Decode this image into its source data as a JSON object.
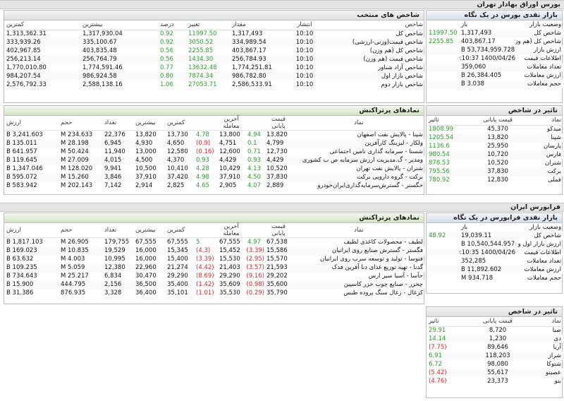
{
  "page": {
    "tse_title": "بورس اوراق بهادار تهران",
    "ifb_title": "فرابورس ایران"
  },
  "tse_indices": {
    "title": "شاخص های منتخب",
    "headers": [
      "شاخص",
      "انتشار",
      "مقدار",
      "تغییر",
      "درصد",
      "بیشترین",
      "کمترین"
    ],
    "rows": [
      {
        "name": "شاخص کل",
        "time": "10:10",
        "value": "1,317,493",
        "change": "11997.50",
        "pct": "0.92",
        "high": "1,317,930.04",
        "low": "1,313,362.31",
        "dir": "pos"
      },
      {
        "name": "شاخص قیمت(وزنی-ارزشی)",
        "time": "10:10",
        "value": "334,989.54",
        "change": "3050.52",
        "pct": "0.92",
        "high": "335,100.67",
        "low": "333,939.26",
        "dir": "pos"
      },
      {
        "name": "شاخص کل (هم وزن)",
        "time": "10:10",
        "value": "403,867.17",
        "change": "2255.85",
        "pct": "0.56",
        "high": "403,835.48",
        "low": "402,967.85",
        "dir": "pos"
      },
      {
        "name": "شاخص قیمت (هم وزن)",
        "time": "10:10",
        "value": "256,784.93",
        "change": "1434.30",
        "pct": "0.56",
        "high": "256,764.79",
        "low": "256,213.14",
        "dir": "pos"
      },
      {
        "name": "شاخص آزاد شناور",
        "time": "10:10",
        "value": "1,774,251.81",
        "change": "13632.48",
        "pct": "0.77",
        "high": "1,774,591.46",
        "low": "1,770,010.80",
        "dir": "pos"
      },
      {
        "name": "شاخص بازار اول",
        "time": "10:10",
        "value": "986,782.80",
        "change": "7874.34",
        "pct": "0.80",
        "high": "986,924.58",
        "low": "984,207.54",
        "dir": "pos"
      },
      {
        "name": "شاخص بازار دوم",
        "time": "10:10",
        "value": "2,586,533.91",
        "change": "27053.71",
        "pct": "1.06",
        "high": "2,588,138.16",
        "low": "2,576,792.33",
        "dir": "pos"
      }
    ]
  },
  "tse_overview": {
    "title": "بازار نقدی بورس در یک نگاه",
    "rows": [
      {
        "label": "وضعیت بازار",
        "value": "باز",
        "extra": ""
      },
      {
        "label": "شاخص کل",
        "value": "1,317,493",
        "extra": "11997.50"
      },
      {
        "label": "شاخص کل (هم وزن)",
        "value": "403,867.17",
        "extra": "2255.85"
      },
      {
        "label": "ارزش بازار",
        "value": "53,734,959.728 B",
        "extra": ""
      },
      {
        "label": "اطلاعات قیمت",
        "value": "1400/04/26 10:10:37",
        "extra": ""
      },
      {
        "label": "تعداد معاملات",
        "value": "359,060",
        "extra": ""
      },
      {
        "label": "ارزش معاملات",
        "value": "26,384.405 B",
        "extra": ""
      },
      {
        "label": "حجم معاملات",
        "value": "3.038 B",
        "extra": ""
      }
    ]
  },
  "tse_top": {
    "title": "نمادهای پرتراکنش",
    "headers": [
      "نماد",
      "قیمت پایانی",
      "",
      "آخرین معامله",
      "",
      "کمترین",
      "بیشترین",
      "تعداد",
      "حجم",
      "ارزش"
    ],
    "rows": [
      {
        "name": "شپنا - پالایش نفت اصفهان",
        "close": "13,820",
        "close_pct": "4.94",
        "last": "13,800",
        "last_pct": "4.78",
        "low": "13,730",
        "high": "13,820",
        "count": "22,376",
        "volume": "234.633 M",
        "value": "3,241.603 B",
        "cdir": "pos",
        "ldir": "pos"
      },
      {
        "name": "ولکار - لیزینگ کارآفرین",
        "close": "4,799",
        "close_pct": "0.1",
        "last": "4,751",
        "last_pct": "(0.9)",
        "low": "4,650",
        "high": "4,930",
        "count": "6,945",
        "volume": "28.198 M",
        "value": "135.011 B",
        "cdir": "pos",
        "ldir": "neg"
      },
      {
        "name": "شستا - سرمایه گذاری تامین اجتماعی",
        "close": "12,730",
        "close_pct": "0.71",
        "last": "12,600",
        "last_pct": "(0.16)",
        "low": "12,580",
        "high": "13,000",
        "count": "11,940",
        "volume": "50.424 M",
        "value": "641.957 B",
        "cdir": "pos",
        "ldir": "neg"
      },
      {
        "name": "ومدیر - گ.مدیریت ارزش سرمایه ص ب کشوری",
        "close": "4,429",
        "close_pct": "0.93",
        "last": "4,429",
        "last_pct": "0.93",
        "low": "4,370",
        "high": "4,500",
        "count": "4,015",
        "volume": "27.009 M",
        "value": "119.645 B",
        "cdir": "pos",
        "ldir": "pos"
      },
      {
        "name": "شتران - پالایش نفت تهران",
        "close": "10,520",
        "close_pct": "4.13",
        "last": "10,429",
        "last_pct": "4.28",
        "low": "10,410",
        "high": "10,500",
        "count": "9,941",
        "volume": "128.020 M",
        "value": "1,347.046 B",
        "cdir": "pos",
        "ldir": "pos"
      },
      {
        "name": "برکت - گروه دارویی برکت",
        "close": "37,830",
        "close_pct": "4.50",
        "last": "37,910",
        "last_pct": "4.98",
        "low": "37,420",
        "high": "37,910",
        "count": "3,846",
        "volume": "15.260 M",
        "value": "595.072 B",
        "cdir": "pos",
        "ldir": "pos"
      },
      {
        "name": "خگستر - گسترش‌سرمایه‌گذاری‌ایران‌خودرو",
        "close": "2,889",
        "close_pct": "4.07",
        "last": "2,905",
        "last_pct": "4.65",
        "low": "2,825",
        "high": "2,914",
        "count": "7,142",
        "volume": "202.143 M",
        "value": "583.942 B",
        "cdir": "pos",
        "ldir": "pos"
      }
    ]
  },
  "tse_impact": {
    "title": "تاثیر در شاخص",
    "headers": [
      "نماد",
      "قیمت پایانی",
      "تاثیر"
    ],
    "rows": [
      {
        "name": "میدکو",
        "close": "45,370",
        "impact": "1808.99",
        "dir": "pos"
      },
      {
        "name": "شپنا",
        "close": "13,820",
        "impact": "1205.54",
        "dir": "pos"
      },
      {
        "name": "پارسان",
        "close": "25,950",
        "impact": "1136.6",
        "dir": "pos"
      },
      {
        "name": "فارس",
        "close": "10,720",
        "impact": "980.54",
        "dir": "pos"
      },
      {
        "name": "شتران",
        "close": "10,520",
        "impact": "878.53",
        "dir": "pos"
      },
      {
        "name": "برکت",
        "close": "37,830",
        "impact": "795.56",
        "dir": "pos"
      },
      {
        "name": "فملی",
        "close": "12,830",
        "impact": "780.92",
        "dir": "pos"
      }
    ]
  },
  "ifb_top": {
    "title": "نمادهای پرتراکنش",
    "headers": [
      "نماد",
      "قیمت پایانی",
      "",
      "آخرین معامله",
      "",
      "کمترین",
      "بیشترین",
      "تعداد",
      "حجم",
      "ارزش"
    ],
    "rows": [
      {
        "name": "لطیف - محصولات کاغذی لطیف",
        "close": "67,538",
        "close_pct": "4.97",
        "last": "67,555",
        "last_pct": "5",
        "low": "67,555",
        "high": "67,555",
        "count": "179,755",
        "volume": "26.905 M",
        "value": "1,817.103 B",
        "cdir": "pos",
        "ldir": "pos"
      },
      {
        "name": "فگستر - گسترش صنایع روی ایرانیان",
        "close": "15,586",
        "close_pct": "(3.39)",
        "last": "15,452",
        "last_pct": "(4.3)",
        "low": "15,345",
        "high": "16,000",
        "count": "19,529",
        "volume": "10.835 M",
        "value": "169.023 B",
        "cdir": "neg",
        "ldir": "neg"
      },
      {
        "name": "فنوسا - تولید و توسعه سرب روی ایرانیان",
        "close": "15,570",
        "close_pct": "(2.95)",
        "last": "15,530",
        "last_pct": "(3.39)",
        "low": "15,400",
        "high": "16,000",
        "count": "10,995",
        "volume": "4.003 M",
        "value": "63.632 B",
        "cdir": "neg",
        "ldir": "neg"
      },
      {
        "name": "گدنا - تهیه توزیع غذای دنا آفرین فدک",
        "close": "21,593",
        "close_pct": "(3.57)",
        "last": "21,403",
        "last_pct": "(4.42)",
        "low": "21,274",
        "high": "22,960",
        "count": "12,380",
        "volume": "5.059 M",
        "value": "109.235 B",
        "cdir": "neg",
        "ldir": "neg"
      },
      {
        "name": "حآسا - آسیا سیر ارس",
        "close": "29,202",
        "close_pct": "(9.16)",
        "last": "29,290",
        "last_pct": "(8.69)",
        "low": "29,290",
        "high": "30,470",
        "count": "6,834",
        "volume": "25.217 M",
        "value": "734.643 B",
        "cdir": "neg",
        "ldir": "neg"
      },
      {
        "name": "چخزر - صنایع چوب خزر کاسپین",
        "close": "35,600",
        "close_pct": "(0.98)",
        "last": "35,609",
        "last_pct": "(1.42)",
        "low": "35,400",
        "high": "36,500",
        "count": "2,156",
        "volume": "444.795",
        "value": "15.900 B",
        "cdir": "neg",
        "ldir": "neg"
      },
      {
        "name": "کزغال - زغال سنگ پروده طبس",
        "close": "35,790",
        "close_pct": "(0.29)",
        "last": "35,530",
        "last_pct": "(1.01)",
        "low": "35,101",
        "high": "36,400",
        "count": "3,328",
        "volume": "876.935",
        "value": "31.386 B",
        "cdir": "neg",
        "ldir": "neg"
      }
    ]
  },
  "ifb_overview": {
    "title": "بازار نقدی فرابورس در یک نگاه",
    "rows": [
      {
        "label": "وضعیت بازار",
        "value": "باز",
        "extra": ""
      },
      {
        "label": "شاخص کل",
        "value": "19,039.11",
        "extra": "48.92"
      },
      {
        "label": "ارزش بازار اول و دوم",
        "value": "10,540,544.957 B",
        "extra": ""
      },
      {
        "label": "اطلاعات قیمت",
        "value": "1400/04/26 10:10:35",
        "extra": ""
      },
      {
        "label": "تعداد معاملات",
        "value": "352,285",
        "extra": ""
      },
      {
        "label": "ارزش معاملات",
        "value": "11,892.602 B",
        "extra": ""
      },
      {
        "label": "حجم معاملات",
        "value": "934.718 M",
        "extra": ""
      }
    ]
  },
  "ifb_impact": {
    "title": "تاثیر در شاخص",
    "headers": [
      "نماد",
      "قیمت پایانی",
      "تاثیر"
    ],
    "rows": [
      {
        "name": "صبا",
        "close": "8,720",
        "impact": "29.91",
        "dir": "pos"
      },
      {
        "name": "دی",
        "close": "1,230",
        "impact": "14.14",
        "dir": "pos"
      },
      {
        "name": "آریا",
        "close": "89,646",
        "impact": "(7.75)",
        "dir": "neg"
      },
      {
        "name": "شراز",
        "close": "118,203",
        "impact": "6.91",
        "dir": "pos"
      },
      {
        "name": "شتوکا",
        "close": "98,080",
        "impact": "6.72",
        "dir": "pos"
      },
      {
        "name": "عصیتو",
        "close": "55,617",
        "impact": "(5.42)",
        "dir": "neg"
      },
      {
        "name": "بنو",
        "close": "23,373",
        "impact": "(4.76)",
        "dir": "neg"
      }
    ]
  }
}
